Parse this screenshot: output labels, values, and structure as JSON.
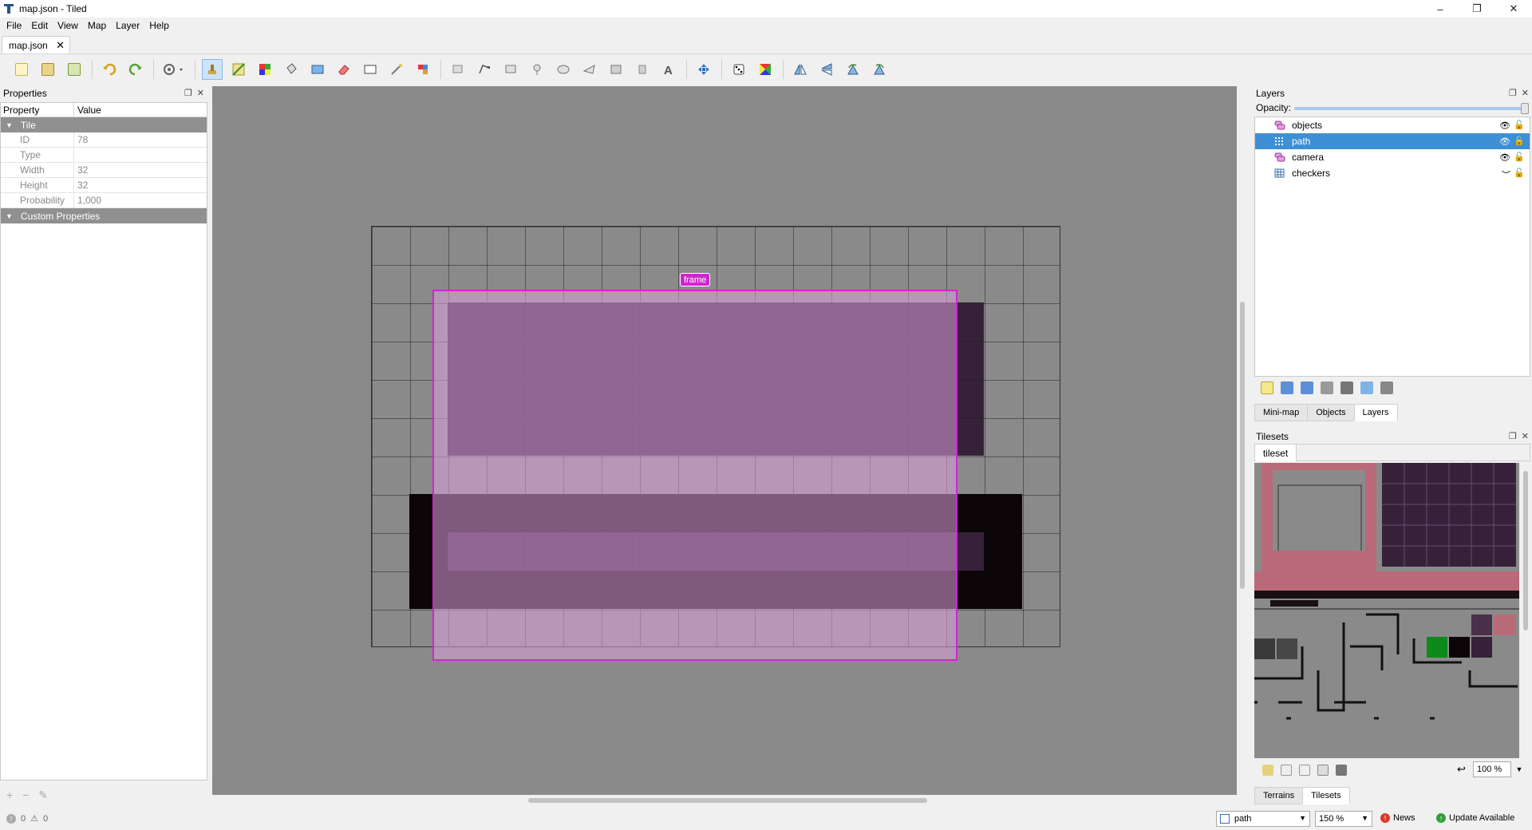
{
  "window": {
    "title": "map.json - Tiled",
    "controls": [
      "–",
      "❐",
      "✕"
    ]
  },
  "menu": [
    "File",
    "Edit",
    "View",
    "Map",
    "Layer",
    "Help"
  ],
  "document_tab": {
    "label": "map.json",
    "close": "✕"
  },
  "toolbar": {
    "icons": [
      "new-icon",
      "open-icon",
      "save-icon",
      "undo-icon",
      "redo-icon",
      "commands-icon",
      "stamp-brush-icon",
      "terrain-brush-icon",
      "wang-brush-icon",
      "bucket-fill-icon",
      "shape-fill-icon",
      "eraser-icon",
      "rectangle-select-icon",
      "magic-wand-icon",
      "select-same-tile-icon",
      "select-objects-icon",
      "edit-polygons-icon",
      "insert-rectangle-icon",
      "insert-point-icon",
      "insert-ellipse-icon",
      "insert-polygon-icon",
      "insert-tile-icon",
      "insert-template-icon",
      "insert-text-icon",
      "move-icon",
      "random-mode-icon",
      "wang-fill-icon",
      "flip-horizontal-icon",
      "flip-vertical-icon",
      "rotate-left-icon",
      "rotate-right-icon"
    ]
  },
  "properties_panel": {
    "title": "Properties",
    "header": {
      "property": "Property",
      "value": "Value"
    },
    "group_tile": "Tile",
    "rows": [
      {
        "key": "ID",
        "value": "78"
      },
      {
        "key": "Type",
        "value": ""
      },
      {
        "key": "Width",
        "value": "32"
      },
      {
        "key": "Height",
        "value": "32"
      },
      {
        "key": "Probability",
        "value": "1,000"
      }
    ],
    "group_custom": "Custom Properties"
  },
  "map": {
    "object_label": "frame"
  },
  "layers_panel": {
    "title": "Layers",
    "opacity_label": "Opacity:",
    "opacity": 1.0,
    "layers": [
      {
        "name": "objects",
        "type": "object-layer",
        "visible": true,
        "selected": false
      },
      {
        "name": "path",
        "type": "tile-layer",
        "visible": true,
        "selected": true
      },
      {
        "name": "camera",
        "type": "object-layer",
        "visible": true,
        "selected": false
      },
      {
        "name": "checkers",
        "type": "tile-layer",
        "visible": false,
        "selected": false
      }
    ],
    "tabs": [
      "Mini-map",
      "Objects",
      "Layers"
    ],
    "active_tab": "Layers"
  },
  "tilesets_panel": {
    "title": "Tilesets",
    "tab": "tileset",
    "zoom": "100 %",
    "tabs": [
      "Terrains",
      "Tilesets"
    ],
    "active_tab": "Tilesets"
  },
  "status": {
    "errors": "0",
    "warnings": "0",
    "current_layer": "path",
    "zoom": "150 %",
    "news": "News",
    "update": "Update Available"
  },
  "colors": {
    "accent_selection": "#3d8fd6",
    "object_frame": "#d026d0",
    "canvas_bg": "#8a8a8a"
  }
}
